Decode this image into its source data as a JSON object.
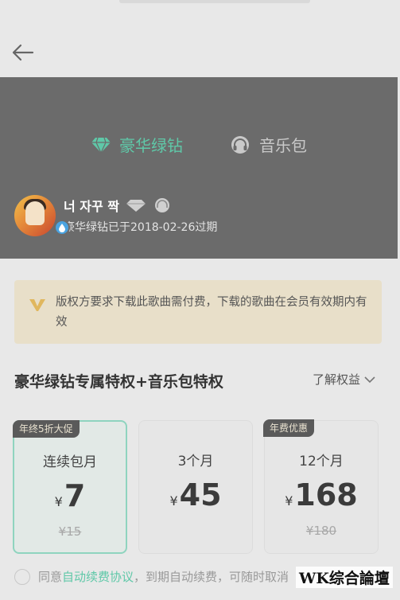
{
  "tabs": [
    {
      "label": "豪华绿钻",
      "icon": "diamond-icon",
      "active": true
    },
    {
      "label": "音乐包",
      "icon": "headphones-icon",
      "active": false
    }
  ],
  "user": {
    "name": "너 자꾸 짝",
    "vip_status": "豪华绿钻已于2018-02-26过期"
  },
  "notice": {
    "text": "版权方要求下载此歌曲需付费，下载的歌曲在会员有效期内有效"
  },
  "section": {
    "title": "豪华绿钻专属特权+音乐包特权",
    "learn_more": "了解权益"
  },
  "plans": [
    {
      "tag": "年终5折大促",
      "name": "连续包月",
      "currency": "¥",
      "price": "7",
      "original": "¥15",
      "selected": true
    },
    {
      "tag": "",
      "name": "3个月",
      "currency": "¥",
      "price": "45",
      "original": "",
      "selected": false
    },
    {
      "tag": "年费优惠",
      "name": "12个月",
      "currency": "¥",
      "price": "168",
      "original": "¥180",
      "selected": false
    }
  ],
  "agreement": {
    "prefix": "同意",
    "link": "自动续费协议",
    "suffix": "，到期自动续费，可随时取消"
  },
  "watermark": "WK综合論壇",
  "colors": {
    "accent": "#5fc8a8",
    "header_bg": "#6b6b6b",
    "notice_bg": "#e8dfc9"
  }
}
